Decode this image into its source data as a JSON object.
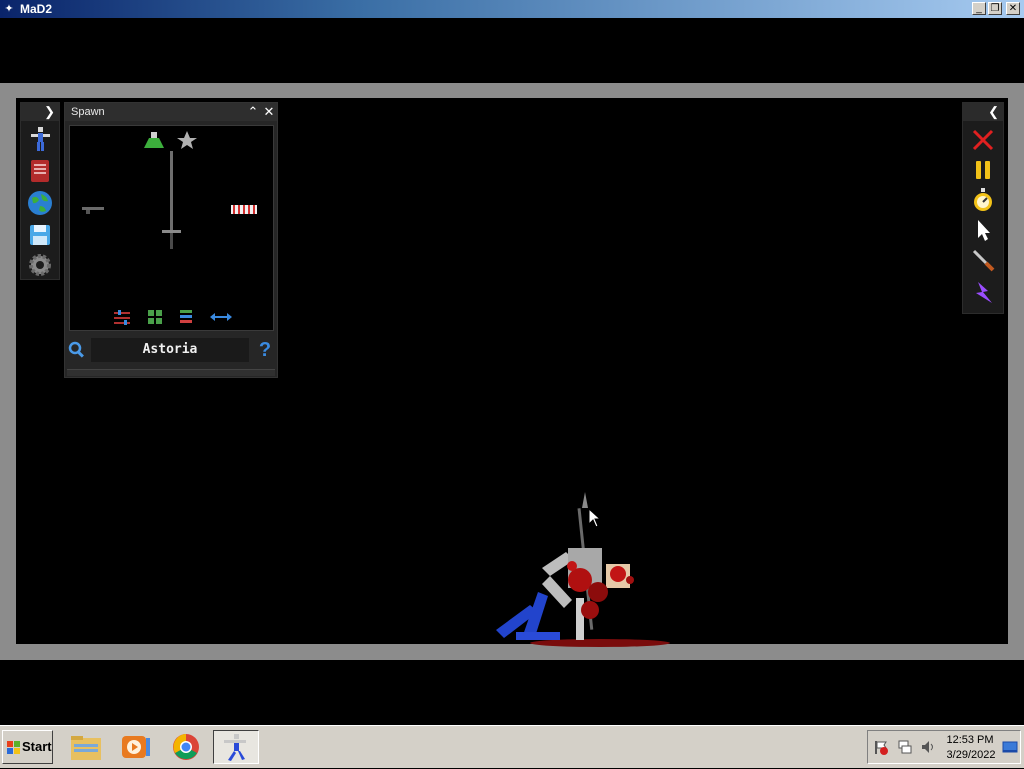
{
  "window": {
    "title": "MaD2"
  },
  "left_tools": [
    {
      "icon": "humanoid-icon"
    },
    {
      "icon": "book-icon"
    },
    {
      "icon": "globe-icon"
    },
    {
      "icon": "save-icon"
    },
    {
      "icon": "gear-icon"
    }
  ],
  "spawn": {
    "title": "Spawn",
    "search_value": "Astoria",
    "items": [
      "flask-icon",
      "star-icon",
      "sword-icon",
      "rifle-icon",
      "striped-block-icon"
    ],
    "filter_icons": [
      "sliders-icon",
      "grid-icon",
      "list-icon",
      "swap-icon"
    ]
  },
  "right_tools": [
    {
      "icon": "close-x-icon",
      "color": "#e02020"
    },
    {
      "icon": "pause-icon",
      "color": "#f2c218"
    },
    {
      "icon": "stopwatch-icon",
      "color": "#f2c218"
    },
    {
      "icon": "pointer-icon",
      "color": "#ffffff"
    },
    {
      "icon": "knife-icon",
      "color": "#c8c8c8"
    },
    {
      "icon": "lightning-icon",
      "color": "#9b4dff"
    }
  ],
  "taskbar": {
    "start_label": "Start",
    "apps": [
      "file-explorer-icon",
      "media-player-icon",
      "chrome-icon",
      "mad2-icon"
    ],
    "time": "12:53 PM",
    "date": "3/29/2022"
  }
}
